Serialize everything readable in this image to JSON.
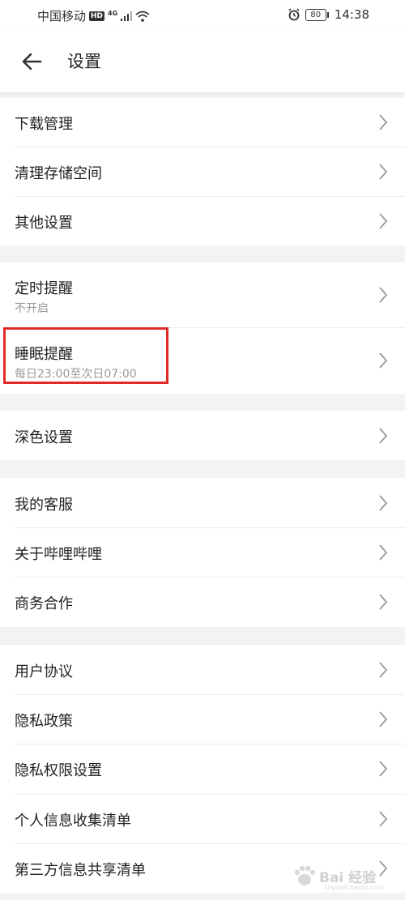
{
  "status_bar": {
    "carrier": "中国移动",
    "hd": "HD",
    "net": "4G",
    "battery": "80",
    "time": "14:38"
  },
  "header": {
    "title": "设置"
  },
  "settings": {
    "download": "下载管理",
    "storage": "清理存储空间",
    "other": "其他设置",
    "timer_title": "定时提醒",
    "timer_sub": "不开启",
    "sleep_title": "睡眠提醒",
    "sleep_sub": "每日23:00至次日07:00",
    "dark": "深色设置",
    "service": "我的客服",
    "about": "关于哔哩哔哩",
    "business": "商务合作",
    "agreement": "用户协议",
    "privacy": "隐私政策",
    "permissions": "隐私权限设置",
    "personal_info": "个人信息收集清单",
    "third_party": "第三方信息共享清单"
  },
  "watermark": {
    "text": "Bai 经验",
    "sub": "jingyan.baidu.com"
  },
  "colors": {
    "highlight": "#e02a2a",
    "background": "#f3f3f3"
  }
}
